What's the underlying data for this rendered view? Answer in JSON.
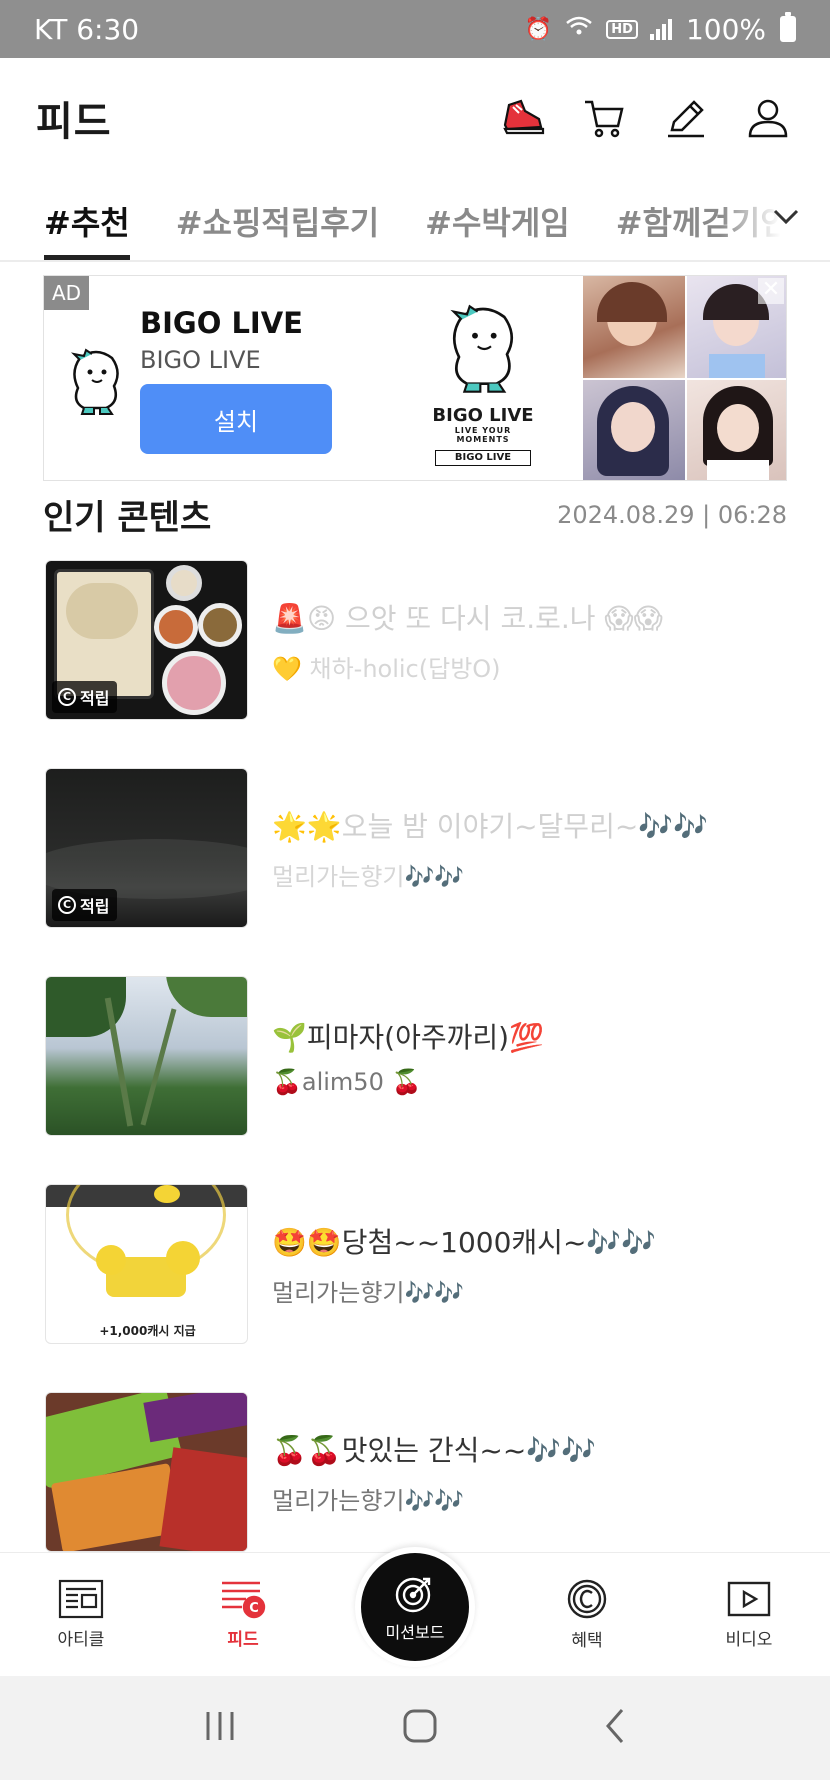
{
  "status_bar": {
    "carrier_time": "KT 6:30",
    "battery": "100%"
  },
  "header": {
    "title": "피드"
  },
  "tabs": [
    {
      "label": "#추천",
      "active": true
    },
    {
      "label": "#쇼핑적립후기",
      "active": false
    },
    {
      "label": "#수박게임",
      "active": false
    },
    {
      "label": "#함께걷기인증",
      "active": false
    }
  ],
  "ad": {
    "badge": "AD",
    "title": "BIGO LIVE",
    "subtitle": "BIGO LIVE",
    "install_label": "설치",
    "brand_name": "BIGO LIVE",
    "brand_tagline": "LIVE YOUR MOMENTS",
    "brand_box": "BIGO LIVE",
    "close": "✕"
  },
  "popular": {
    "title": "인기 콘텐츠",
    "date": "2024.08.29 | 06:28"
  },
  "feed": [
    {
      "title": "🚨😡 으앗 또 다시 코.로.나 😱😱",
      "author": "💛 채하-holic(답방O)",
      "badge": "적립",
      "faded": true
    },
    {
      "title": "🌟🌟오늘 밤 이야기~달무리~🎶🎶",
      "author": "멀리가는향기🎶🎶",
      "badge": "적립",
      "faded": true
    },
    {
      "title": "🌱피마자(아주까리)💯",
      "author": "🍒alim50 🍒",
      "badge": "",
      "faded": false
    },
    {
      "title": "🤩🤩당첨~~1000캐시~🎶🎶",
      "author": "멀리가는향기🎶🎶",
      "badge": "",
      "faded": false,
      "thumb_caption": "+1,000캐시 지급"
    },
    {
      "title": "🍒🍒맛있는 간식~~🎶🎶",
      "author": "멀리가는향기🎶🎶",
      "badge": "",
      "faded": false
    }
  ],
  "bottom_nav": {
    "article": "아티클",
    "feed": "피드",
    "mission": "미션보드",
    "benefit": "혜택",
    "video": "비디오"
  },
  "colors": {
    "accent": "#e4323b",
    "install_blue": "#4f8ef7"
  }
}
